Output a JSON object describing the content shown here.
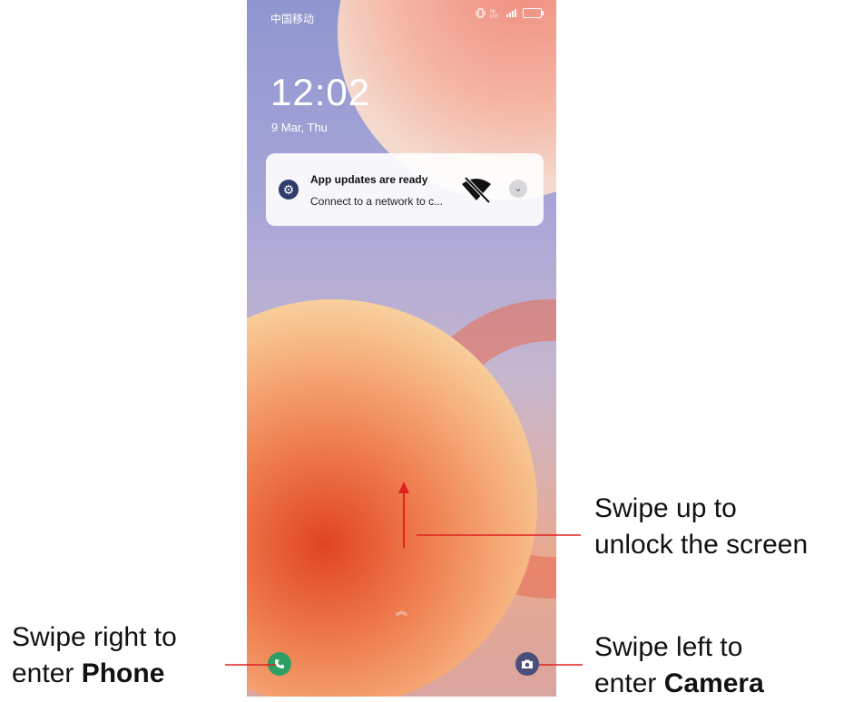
{
  "status_bar": {
    "carrier": "中国移动",
    "icons": [
      "vibrate-icon",
      "volte-icon",
      "signal-icon",
      "battery-icon"
    ]
  },
  "lockscreen": {
    "time": "12:02",
    "date": "9 Mar, Thu"
  },
  "notification": {
    "app_icon": "settings-gear-icon",
    "title": "App updates are ready",
    "body": "Connect to a network to c...",
    "status_icon": "wifi-off-icon",
    "expand_icon": "chevron-down-icon"
  },
  "shortcuts": {
    "left_icon": "phone-icon",
    "right_icon": "camera-icon",
    "swipe_hint_icon": "double-chevron-up-icon"
  },
  "callouts": {
    "unlock_line1": "Swipe up to",
    "unlock_line2": "unlock the screen",
    "phone_line1": "Swipe right to",
    "phone_line2_prefix": "enter ",
    "phone_line2_bold": "Phone",
    "camera_line1": "Swipe left to",
    "camera_line2_prefix": "enter ",
    "camera_line2_bold": "Camera"
  },
  "colors": {
    "callout_line": "#e02020",
    "phone_shortcut": "#2e9f64",
    "camera_shortcut": "#4a4f7a"
  }
}
